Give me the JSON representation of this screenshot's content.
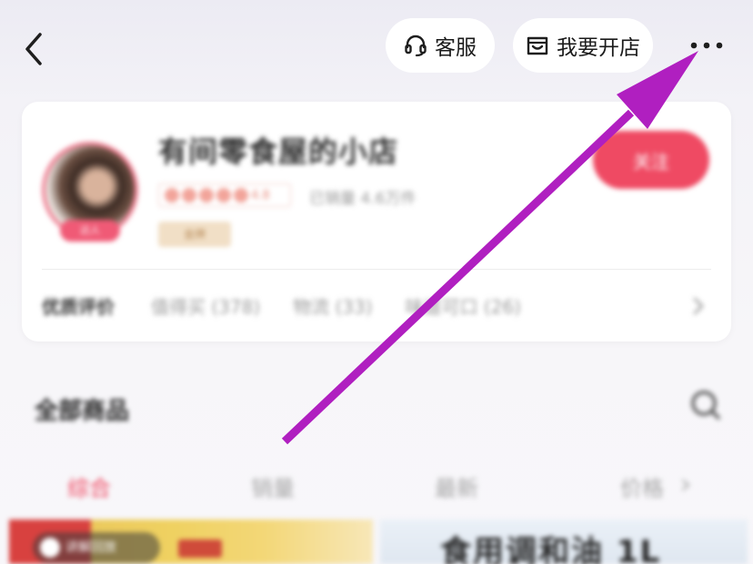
{
  "header": {
    "customer_service_label": "客服",
    "open_shop_label": "我要开店"
  },
  "shop": {
    "name": "有间零食屋的小店",
    "avatar_tag": "达人",
    "rating_text": "4.8",
    "sales_text": "已销量 4.6万件",
    "level_text": "金牌",
    "follow_label": "关注",
    "reviews": {
      "title": "优质评价",
      "tags": [
        "值得买 (378)",
        "物流 (33)",
        "味道可口 (26)"
      ]
    }
  },
  "products_section": {
    "title": "全部商品",
    "tabs": [
      "综合",
      "销量",
      "最新",
      "价格"
    ],
    "active_tab": 0
  },
  "products": [
    {
      "badge_text": "讲解回放"
    },
    {
      "title_text": "食用调和油 1L"
    }
  ],
  "annotation": {
    "arrow_color": "#b01fc0"
  },
  "colors": {
    "accent": "#ef4a63"
  }
}
